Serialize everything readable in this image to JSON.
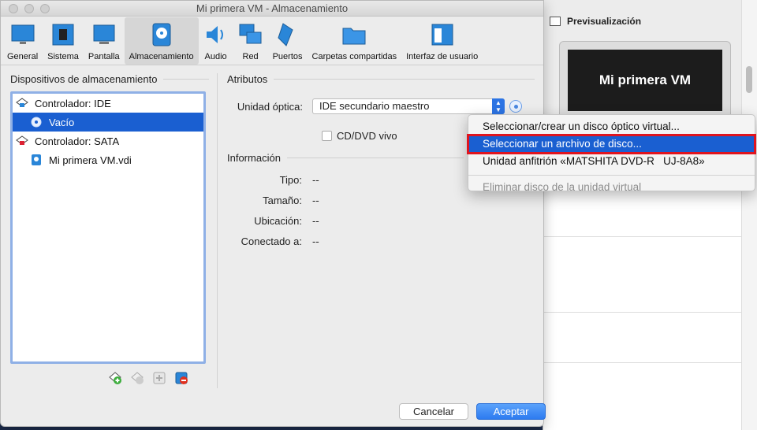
{
  "window": {
    "title": "Mi primera VM - Almacenamiento"
  },
  "toolbar": {
    "items": [
      {
        "label": "General"
      },
      {
        "label": "Sistema"
      },
      {
        "label": "Pantalla"
      },
      {
        "label": "Almacenamiento"
      },
      {
        "label": "Audio"
      },
      {
        "label": "Red"
      },
      {
        "label": "Puertos"
      },
      {
        "label": "Carpetas compartidas"
      },
      {
        "label": "Interfaz de usuario"
      }
    ],
    "active": "Almacenamiento"
  },
  "storage": {
    "title": "Dispositivos de almacenamiento",
    "tree": [
      {
        "label": "Controlador: IDE"
      },
      {
        "label": "Vacío"
      },
      {
        "label": "Controlador: SATA"
      },
      {
        "label": "Mi primera VM.vdi"
      }
    ]
  },
  "attributes": {
    "title": "Atributos",
    "optical_label": "Unidad óptica:",
    "optical_value": "IDE secundario maestro",
    "live_label": "CD/DVD vivo"
  },
  "information": {
    "title": "Información",
    "rows": [
      {
        "key": "Tipo:",
        "value": "--"
      },
      {
        "key": "Tamaño:",
        "value": "--"
      },
      {
        "key": "Ubicación:",
        "value": "--"
      },
      {
        "key": "Conectado a:",
        "value": "--"
      }
    ]
  },
  "menu": {
    "items": [
      {
        "label": "Seleccionar/crear un disco óptico virtual..."
      },
      {
        "label": "Seleccionar un archivo de disco..."
      },
      {
        "label": "Unidad anfitrión «MATSHITA DVD-R   UJ-8A8»"
      },
      {
        "label": "Eliminar disco de la unidad virtual"
      }
    ]
  },
  "buttons": {
    "cancel": "Cancelar",
    "ok": "Aceptar"
  },
  "background": {
    "preview_title": "Previsualización",
    "preview_vm": "Mi primera VM"
  },
  "colors": {
    "selection": "#1a5fd1",
    "highlight_border": "#e0141e",
    "accent": "#2d7bf0"
  }
}
